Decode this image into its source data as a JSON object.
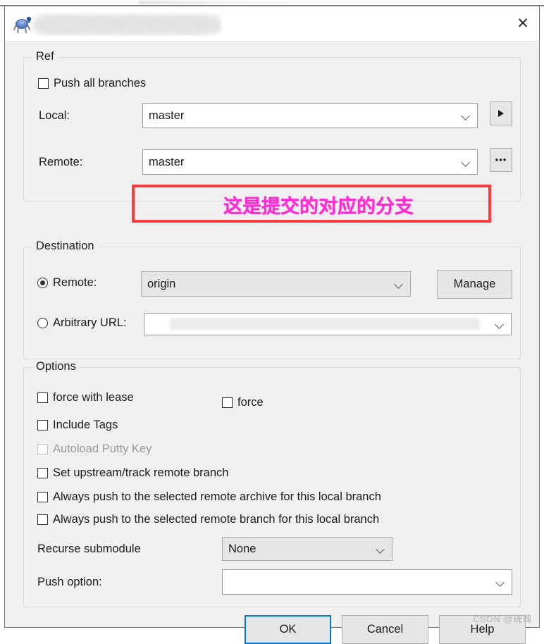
{
  "window": {
    "title": "",
    "title_redacted": true,
    "icon": "git-extensions-icon",
    "close_label": "✕"
  },
  "ref_group": {
    "legend": "Ref",
    "push_all_branches": {
      "label": "Push all branches",
      "checked": false
    },
    "local": {
      "label": "Local:",
      "value": "master",
      "browse_button": "▶"
    },
    "remote": {
      "label": "Remote:",
      "value": "master",
      "browse_button": "•••"
    }
  },
  "destination_group": {
    "legend": "Destination",
    "remote": {
      "label": "Remote:",
      "selected": true,
      "value": "origin",
      "manage_label": "Manage"
    },
    "arbitrary_url": {
      "label": "Arbitrary URL:",
      "selected": false,
      "value": ""
    }
  },
  "options_group": {
    "legend": "Options",
    "force_with_lease": {
      "label": "force with lease",
      "checked": false,
      "disabled": false
    },
    "force": {
      "label": "force",
      "checked": false,
      "disabled": false
    },
    "include_tags": {
      "label": "Include Tags",
      "checked": false,
      "disabled": false
    },
    "autoload_putty_key": {
      "label": "Autoload Putty Key",
      "checked": false,
      "disabled": true
    },
    "set_upstream": {
      "label": "Set upstream/track remote branch",
      "checked": false,
      "disabled": false
    },
    "always_push_archive": {
      "label": "Always push to the selected remote archive for this local branch",
      "checked": false,
      "disabled": false
    },
    "always_push_branch": {
      "label": "Always push to the selected remote branch for this local branch",
      "checked": false,
      "disabled": false
    },
    "recurse_submodule": {
      "label": "Recurse submodule",
      "value": "None"
    },
    "push_option": {
      "label": "Push option:",
      "value": ""
    }
  },
  "buttons": {
    "ok": "OK",
    "cancel": "Cancel",
    "help": "Help"
  },
  "annotation": {
    "text": "这是提交的对应的分支",
    "box_color": "#fa3c3c",
    "text_color": "#ff2ad4"
  },
  "watermark": "CSDN @珖瑰"
}
